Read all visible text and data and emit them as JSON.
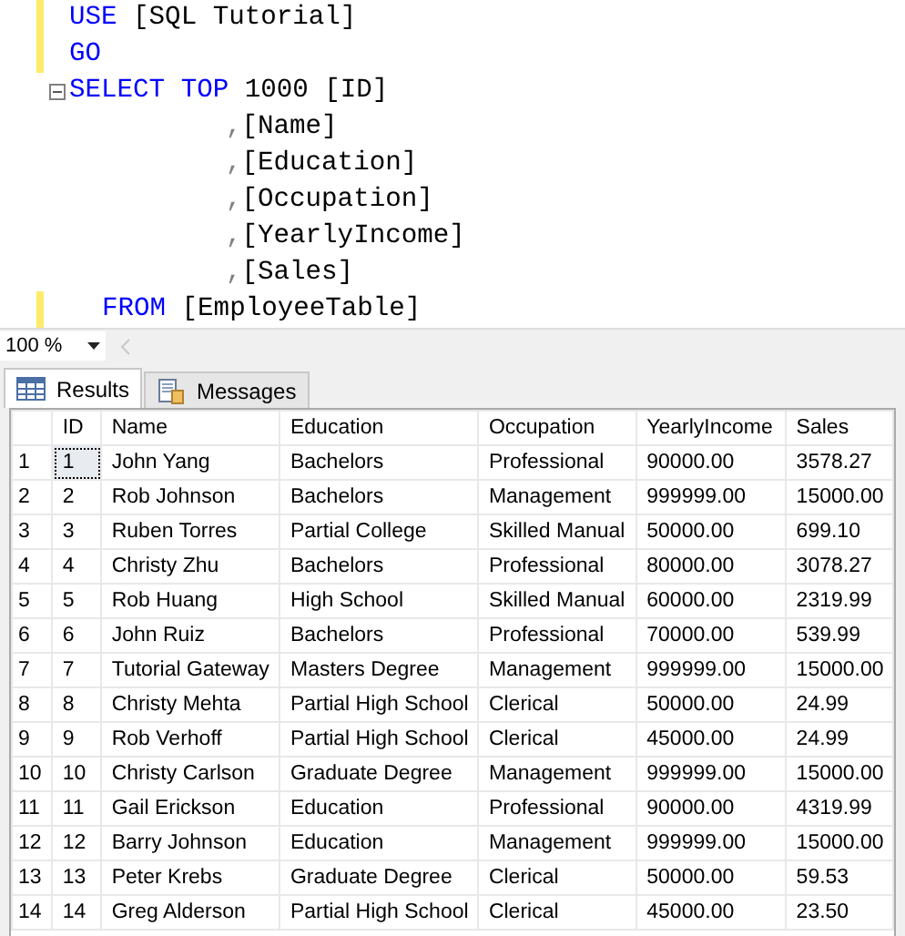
{
  "editor": {
    "lines": [
      {
        "kind": "statement",
        "modified": true,
        "collapsible": false,
        "tokens": [
          {
            "text": "USE",
            "kind": "keyword"
          },
          {
            "text": "[SQL Tutorial]",
            "kind": "plain"
          }
        ]
      },
      {
        "kind": "statement",
        "modified": true,
        "collapsible": false,
        "tokens": [
          {
            "text": "GO",
            "kind": "keyword"
          }
        ]
      },
      {
        "kind": "statement",
        "modified": false,
        "collapsible": true,
        "tokens": [
          {
            "text": "SELECT",
            "kind": "keyword"
          },
          {
            "text": "TOP",
            "kind": "keyword"
          },
          {
            "text": "1000 [ID]",
            "kind": "plain"
          }
        ]
      },
      {
        "kind": "column",
        "modified": false,
        "collapsible": false,
        "tokens": [
          {
            "text": ",",
            "kind": "punct"
          },
          {
            "text": "[Name]",
            "kind": "plain"
          }
        ]
      },
      {
        "kind": "column",
        "modified": false,
        "collapsible": false,
        "tokens": [
          {
            "text": ",",
            "kind": "punct"
          },
          {
            "text": "[Education]",
            "kind": "plain"
          }
        ]
      },
      {
        "kind": "column",
        "modified": false,
        "collapsible": false,
        "tokens": [
          {
            "text": ",",
            "kind": "punct"
          },
          {
            "text": "[Occupation]",
            "kind": "plain"
          }
        ]
      },
      {
        "kind": "column",
        "modified": false,
        "collapsible": false,
        "tokens": [
          {
            "text": ",",
            "kind": "punct"
          },
          {
            "text": "[YearlyIncome]",
            "kind": "plain"
          }
        ]
      },
      {
        "kind": "column",
        "modified": false,
        "collapsible": false,
        "tokens": [
          {
            "text": ",",
            "kind": "punct"
          },
          {
            "text": "[Sales]",
            "kind": "plain"
          }
        ]
      },
      {
        "kind": "clause",
        "modified": true,
        "collapsible": false,
        "tokens": [
          {
            "text": "FROM",
            "kind": "keyword"
          },
          {
            "text": "[EmployeeTable]",
            "kind": "plain"
          }
        ]
      }
    ]
  },
  "zoom": {
    "value": "100 %"
  },
  "tabs": [
    {
      "label": "Results",
      "selected": true
    },
    {
      "label": "Messages",
      "selected": false
    }
  ],
  "table": {
    "columns": [
      "ID",
      "Name",
      "Education",
      "Occupation",
      "YearlyIncome",
      "Sales"
    ],
    "rows": [
      {
        "number": "1",
        "focused": true,
        "cells": [
          "1",
          "John Yang",
          "Bachelors",
          "Professional",
          "90000.00",
          "3578.27"
        ]
      },
      {
        "number": "2",
        "focused": false,
        "cells": [
          "2",
          "Rob Johnson",
          "Bachelors",
          "Management",
          "999999.00",
          "15000.00"
        ]
      },
      {
        "number": "3",
        "focused": false,
        "cells": [
          "3",
          "Ruben Torres",
          "Partial College",
          "Skilled Manual",
          "50000.00",
          "699.10"
        ]
      },
      {
        "number": "4",
        "focused": false,
        "cells": [
          "4",
          "Christy Zhu",
          "Bachelors",
          "Professional",
          "80000.00",
          "3078.27"
        ]
      },
      {
        "number": "5",
        "focused": false,
        "cells": [
          "5",
          "Rob Huang",
          "High School",
          "Skilled Manual",
          "60000.00",
          "2319.99"
        ]
      },
      {
        "number": "6",
        "focused": false,
        "cells": [
          "6",
          "John Ruiz",
          "Bachelors",
          "Professional",
          "70000.00",
          "539.99"
        ]
      },
      {
        "number": "7",
        "focused": false,
        "cells": [
          "7",
          "Tutorial Gateway",
          "Masters Degree",
          "Management",
          "999999.00",
          "15000.00"
        ]
      },
      {
        "number": "8",
        "focused": false,
        "cells": [
          "8",
          "Christy Mehta",
          "Partial High School",
          "Clerical",
          "50000.00",
          "24.99"
        ]
      },
      {
        "number": "9",
        "focused": false,
        "cells": [
          "9",
          "Rob Verhoff",
          "Partial High School",
          "Clerical",
          "45000.00",
          "24.99"
        ]
      },
      {
        "number": "10",
        "focused": false,
        "cells": [
          "10",
          "Christy Carlson",
          "Graduate Degree",
          "Management",
          "999999.00",
          "15000.00"
        ]
      },
      {
        "number": "11",
        "focused": false,
        "cells": [
          "11",
          "Gail Erickson",
          "Education",
          "Professional",
          "90000.00",
          "4319.99"
        ]
      },
      {
        "number": "12",
        "focused": false,
        "cells": [
          "12",
          "Barry Johnson",
          "Education",
          "Management",
          "999999.00",
          "15000.00"
        ]
      },
      {
        "number": "13",
        "focused": false,
        "cells": [
          "13",
          "Peter Krebs",
          "Graduate Degree",
          "Clerical",
          "50000.00",
          "59.53"
        ]
      },
      {
        "number": "14",
        "focused": false,
        "cells": [
          "14",
          "Greg Alderson",
          "Partial High School",
          "Clerical",
          "45000.00",
          "23.50"
        ]
      }
    ]
  }
}
